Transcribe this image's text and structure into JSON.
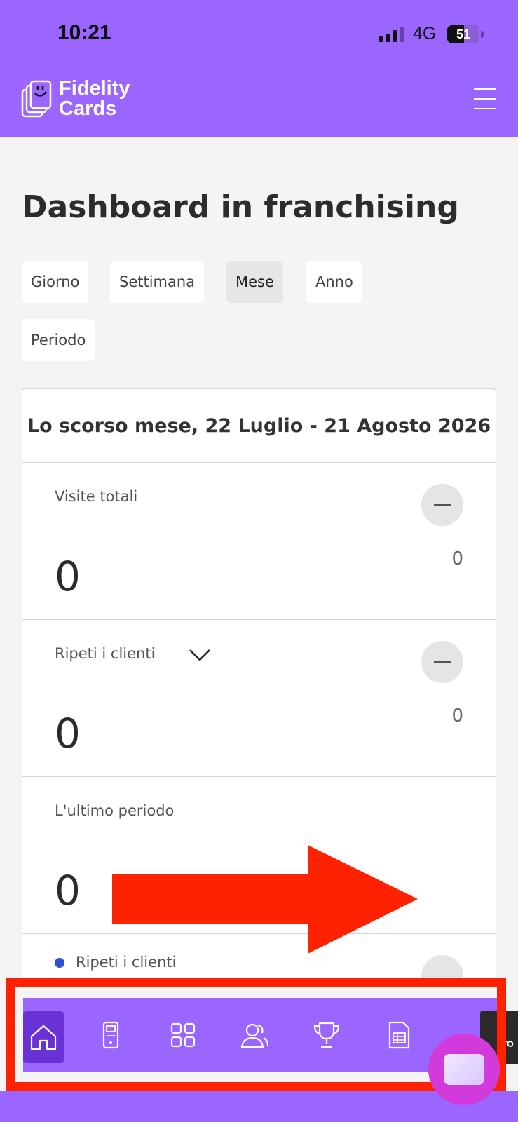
{
  "status_bar": {
    "time": "10:21",
    "network": "4G",
    "battery": "51"
  },
  "header": {
    "brand_line1": "Fidelity",
    "brand_line2": "Cards"
  },
  "page": {
    "title": "Dashboard in franchising"
  },
  "filters": [
    {
      "label": "Giorno",
      "active": false
    },
    {
      "label": "Settimana",
      "active": false
    },
    {
      "label": "Mese",
      "active": true
    },
    {
      "label": "Anno",
      "active": false
    },
    {
      "label": "Periodo",
      "active": false
    }
  ],
  "card": {
    "period": "Lo scorso mese, 22 Luglio - 21 Agosto 2026",
    "stats": [
      {
        "label": "Visite totali",
        "value": "0",
        "compare": "0"
      },
      {
        "label": "Ripeti i clienti",
        "value": "0",
        "compare": "0"
      },
      {
        "label": "L'ultimo periodo",
        "value": "0"
      }
    ],
    "legend_label": "Ripeti i clienti",
    "legend_color": "#2d4fd8"
  },
  "bottom_nav": {
    "items": [
      "home-icon",
      "device-icon",
      "grid-icon",
      "customers-icon",
      "trophy-icon",
      "list-icon",
      "network-icon"
    ]
  },
  "colors": {
    "brand": "#9b66ff",
    "nav_active": "#6a32d6",
    "annotation": "#ff2200",
    "chat_fab": "#d23adb"
  }
}
